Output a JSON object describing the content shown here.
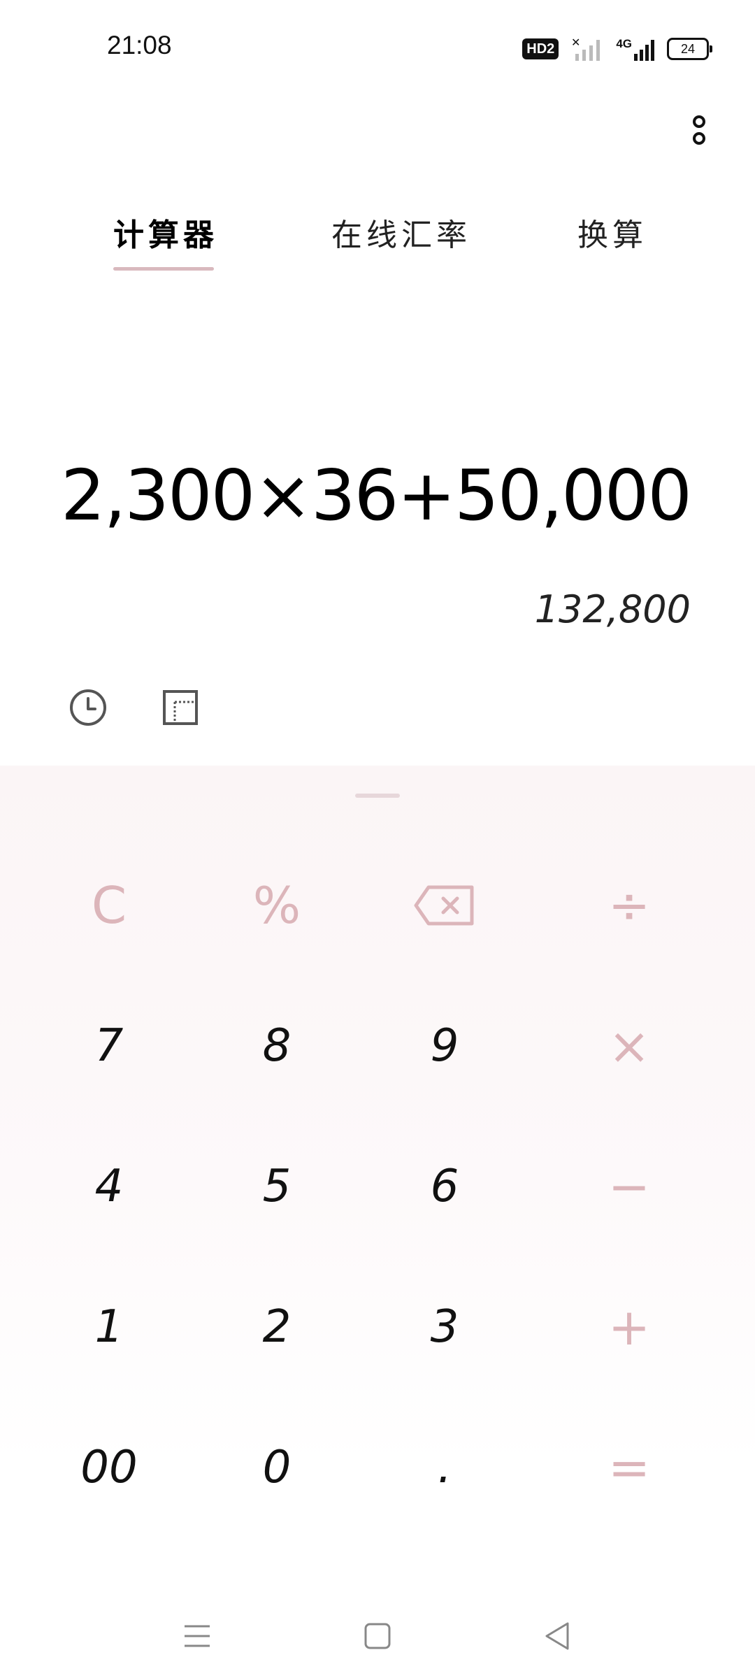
{
  "status_bar": {
    "time": "21:08",
    "hd_label": "HD2",
    "network_label": "4G",
    "battery_level": "24"
  },
  "tabs": [
    {
      "label": "计算器",
      "active": true
    },
    {
      "label": "在线汇率",
      "active": false
    },
    {
      "label": "换算",
      "active": false
    }
  ],
  "display": {
    "expression": "2,300×36+50,000",
    "result": "132,800"
  },
  "keypad": {
    "clear": "C",
    "percent": "%",
    "divide": "÷",
    "multiply": "×",
    "subtract": "−",
    "add": "+",
    "equals": "=",
    "digits": [
      "7",
      "8",
      "9",
      "4",
      "5",
      "6",
      "1",
      "2",
      "3",
      "00",
      "0",
      "."
    ]
  },
  "colors": {
    "accent": "#dcb5ba",
    "tab_underline": "#d9b9be",
    "keypad_background": "#fbf5f6"
  },
  "icons": {
    "history": "clock-icon",
    "layout": "layout-icon",
    "backspace": "backspace-icon",
    "more": "more-vertical-icon",
    "nav_menu": "menu-icon",
    "nav_home": "home-icon",
    "nav_back": "back-icon"
  }
}
